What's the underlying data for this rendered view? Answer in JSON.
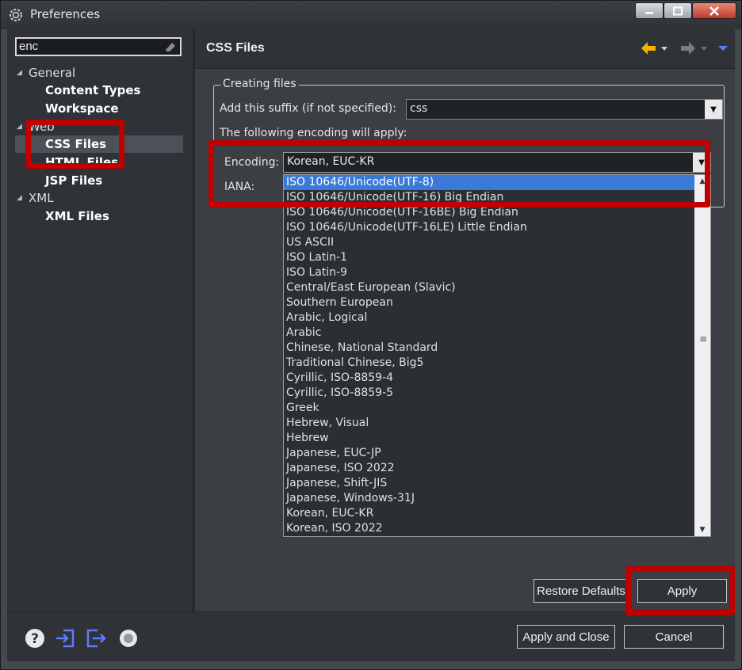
{
  "window": {
    "title": "Preferences"
  },
  "filter": {
    "value": "enc"
  },
  "tree": [
    {
      "label": "General",
      "kind": "category",
      "expanded": true
    },
    {
      "label": "Content Types",
      "kind": "item"
    },
    {
      "label": "Workspace",
      "kind": "item"
    },
    {
      "label": "Web",
      "kind": "category",
      "expanded": true
    },
    {
      "label": "CSS Files",
      "kind": "item",
      "selected": true
    },
    {
      "label": "HTML Files",
      "kind": "item"
    },
    {
      "label": "JSP Files",
      "kind": "item"
    },
    {
      "label": "XML",
      "kind": "category",
      "expanded": true
    },
    {
      "label": "XML Files",
      "kind": "item"
    }
  ],
  "page": {
    "title": "CSS Files",
    "group_title": "Creating files",
    "suffix_label": "Add this suffix (if not specified):",
    "suffix_value": "css",
    "encoding_note": "The following encoding will apply:",
    "encoding_label": "Encoding:",
    "encoding_value": "Korean, EUC-KR",
    "iana_label": "IANA:"
  },
  "encoding_options": [
    "ISO 10646/Unicode(UTF-8)",
    "ISO 10646/Unicode(UTF-16) Big Endian",
    "ISO 10646/Unicode(UTF-16BE) Big Endian",
    "ISO 10646/Unicode(UTF-16LE) Little Endian",
    "US ASCII",
    "ISO Latin-1",
    "ISO Latin-9",
    "Central/East European (Slavic)",
    "Southern European",
    "Arabic, Logical",
    "Arabic",
    "Chinese, National Standard",
    "Traditional Chinese, Big5",
    "Cyrillic, ISO-8859-4",
    "Cyrillic, ISO-8859-5",
    "Greek",
    "Hebrew, Visual",
    "Hebrew",
    "Japanese, EUC-JP",
    "Japanese, ISO 2022",
    "Japanese, Shift-JIS",
    "Japanese, Windows-31J",
    "Korean, EUC-KR",
    "Korean, ISO 2022"
  ],
  "highlighted_option": "ISO 10646/Unicode(UTF-8)",
  "buttons": {
    "restore": "Restore Defaults",
    "apply": "Apply",
    "apply_close": "Apply and Close",
    "cancel": "Cancel"
  },
  "icons": {
    "title": "eclipse-gear-icon",
    "nav_back": "arrow-left-icon",
    "nav_forward": "arrow-right-icon",
    "view_menu": "view-menu-icon",
    "bottom": [
      "help-icon",
      "import-icon",
      "export-icon",
      "oomph-record-icon"
    ]
  },
  "colors": {
    "annotation": "#c00000",
    "selection": "#3a79d8",
    "back_arrow": "#f0b400",
    "bottom_icons": "#5b7cff"
  }
}
